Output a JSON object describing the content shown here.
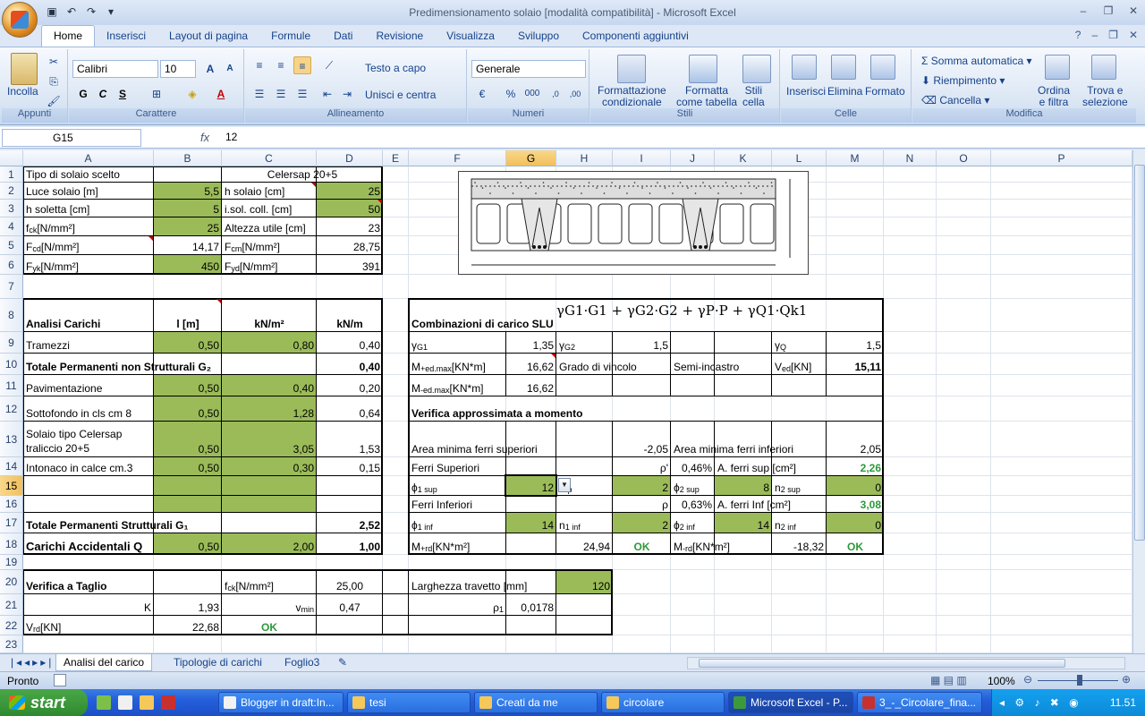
{
  "window": {
    "title": "Predimensionamento solaio  [modalità compatibilità] - Microsoft Excel"
  },
  "tabs": [
    "Home",
    "Inserisci",
    "Layout di pagina",
    "Formule",
    "Dati",
    "Revisione",
    "Visualizza",
    "Sviluppo",
    "Componenti aggiuntivi"
  ],
  "ribbon": {
    "groups": {
      "clipboard": "Appunti",
      "font": "Carattere",
      "alignment": "Allineamento",
      "number": "Numeri",
      "styles": "Stili",
      "cells": "Celle",
      "editing": "Modifica"
    },
    "paste": "Incolla",
    "font_name": "Calibri",
    "font_size": "10",
    "wrap_text": "Testo a capo",
    "merge_center": "Unisci e centra",
    "number_format": "Generale",
    "cond_format": [
      "Formattazione",
      "condizionale"
    ],
    "format_table": [
      "Formatta",
      "come tabella"
    ],
    "cell_styles": [
      "Stili",
      "cella"
    ],
    "insert": "Inserisci",
    "delete": "Elimina",
    "format": "Formato",
    "autosum": "Somma automatica",
    "fill": "Riempimento",
    "clear": "Cancella",
    "sort_filter": [
      "Ordina",
      "e filtra"
    ],
    "find_select": [
      "Trova e",
      "selezione"
    ]
  },
  "formula_bar": {
    "name_box": "G15",
    "fx": "fx",
    "value": "12"
  },
  "columns": [
    "A",
    "B",
    "C",
    "D",
    "E",
    "F",
    "G",
    "H",
    "I",
    "J",
    "K",
    "L",
    "M",
    "N",
    "O",
    "P"
  ],
  "rows": [
    "1",
    "2",
    "3",
    "4",
    "5",
    "6",
    "7",
    "8",
    "9",
    "10",
    "11",
    "12",
    "13",
    "14",
    "15",
    "16",
    "17",
    "18",
    "19",
    "20",
    "21",
    "22",
    "23"
  ],
  "cells": {
    "A1": "Tipo di solaio scelto",
    "C1": "Celersap 20+5",
    "A2": "Luce solaio [m]",
    "B2": "5,5",
    "C2": "h solaio [cm]",
    "D2": "25",
    "A3": "h soletta [cm]",
    "B3": "5",
    "C3": "i.sol. coll. [cm]",
    "D3": "50",
    "A4": "f",
    "A4s": "ck",
    "A4t": " [N/mm²]",
    "B4": "25",
    "C4": "Altezza utile [cm]",
    "D4": "23",
    "A5": "F",
    "A5s": "cd",
    "A5t": " [N/mm²]",
    "B5": "14,17",
    "C5": "F",
    "C5s": "cm",
    "C5t": " [N/mm²]",
    "D5": "28,75",
    "A6": "F",
    "A6s": "yk",
    "A6t": " [N/mm²]",
    "B6": "450",
    "C6": "F",
    "C6s": "yd",
    "C6t": " [N/mm²]",
    "D6": "391",
    "A8": "Analisi Carichi",
    "B8": "l [m]",
    "C8": "kN/m²",
    "D8": "kN/m",
    "A9": "Tramezzi",
    "B9": "0,50",
    "C9": "0,80",
    "D9": "0,40",
    "A10": "Totale Permanenti non Strutturali G₂",
    "D10": "0,40",
    "A11": "Pavimentazione",
    "B11": "0,50",
    "C11": "0,40",
    "D11": "0,20",
    "A12": "Sottofondo in cls cm 8",
    "B12": "0,50",
    "C12": "1,28",
    "D12": "0,64",
    "A13a": "Solaio tipo Celersap",
    "A13b": "tralicciо 20+5",
    "B13": "0,50",
    "C13": "3,05",
    "D13": "1,53",
    "A14": "Intonaco in calce cm.3",
    "B14": "0,50",
    "C14": "0,30",
    "D14": "0,15",
    "A17": "Totale Permanenti Strutturali G₁",
    "D17": "2,52",
    "A18": "Carichi Accidentali Q",
    "B18": "0,50",
    "C18": "2,00",
    "D18": "1,00",
    "A20": "Verifica a Taglio",
    "C20": "f",
    "C20s": "ck",
    "C20t": " [N/mm²]",
    "D20": "25,00",
    "A21": "K",
    "B21": "1,93",
    "C21": "v",
    "C21s": "min",
    "D21": "0,47",
    "A22": "V",
    "A22s": "rd",
    "A22t": " [KN]",
    "B22": "22,68",
    "C22": "OK",
    "F8": "Combinazioni di carico SLU",
    "F9": "γ",
    "F9s": "G1",
    "G9": "1,35",
    "H9": "γ",
    "H9s": "G2",
    "I9": "1,5",
    "L9": "γ",
    "L9s": "Q",
    "M9": "1,5",
    "F10": "M",
    "F10p": "+",
    "F10s": "ed.max",
    "F10t": " [KN*m]",
    "G10": "16,62",
    "H10": "Grado di vincolo",
    "J10": "Semi-incastro",
    "L10": "V",
    "L10s": "ed",
    "L10t": " [KN]",
    "M10": "15,11",
    "F11": "M",
    "F11p": "-",
    "F11s": "ed.max",
    "F11t": " [KN*m]",
    "G11": "16,62",
    "F12": "Verifica approssimata a momento",
    "F13": "Area minima ferri superiori",
    "I13": "-2,05",
    "J13": "Area minima ferri inferiori",
    "M13": "2,05",
    "F14": "Ferri Superiori",
    "I14": "ρ'",
    "J14": "0,46%",
    "K14": "A. ferri sup [cm²]",
    "M14": "2,26",
    "F15": "ϕ",
    "F15s": "1 sup",
    "G15": "12",
    "H15s": " sup",
    "I15": "2",
    "J15": "ϕ",
    "J15s": "2 sup",
    "K15": "8",
    "L15": "n",
    "L15s": "2 sup",
    "M15": "0",
    "F16": "Ferri Inferiori",
    "I16": "ρ",
    "J16": "0,63%",
    "K16": "A. ferri Inf [cm²]",
    "M16": "3,08",
    "F17": "ϕ",
    "F17s": "1 inf",
    "G17": "14",
    "H17": "n",
    "H17s": "1 inf",
    "I17": "2",
    "J17": "ϕ",
    "J17s": "2 inf",
    "K17": "14",
    "L17": "n",
    "L17s": "2 inf",
    "M17": "0",
    "F18": "M",
    "F18p": "+",
    "F18s": "rd",
    "F18t": " [KN*m²]",
    "H18": "24,94",
    "I18": "OK",
    "J18": "M",
    "J18p": "-",
    "J18s": "rd",
    "J18t": " [KN*m²]",
    "L18": "-18,32",
    "M18": "OK",
    "F20": "Larghezza travetto [mm]",
    "H20": "120",
    "F21": "ρ",
    "F21s": "1",
    "G21": "0,0178"
  },
  "formula_image": "γG1·G1 + γG2·G2 + γP·P + γQ1·Qk1",
  "sheet_tabs": [
    "Analisi del carico",
    "Tipologie di carichi",
    "Foglio3"
  ],
  "status": {
    "mode": "Pronto",
    "zoom": "100%"
  },
  "taskbar": {
    "start": "start",
    "tasks": [
      "Blogger in draft:In...",
      "tesi",
      "Creati da me",
      "circolare",
      "Microsoft Excel - P...",
      "3_-_Circolare_fina..."
    ],
    "clock": "11.51"
  },
  "colors": {
    "green_fill": "#9bbb59",
    "ok_text": "#2c9a3a",
    "selection": "#f2bf5c"
  }
}
